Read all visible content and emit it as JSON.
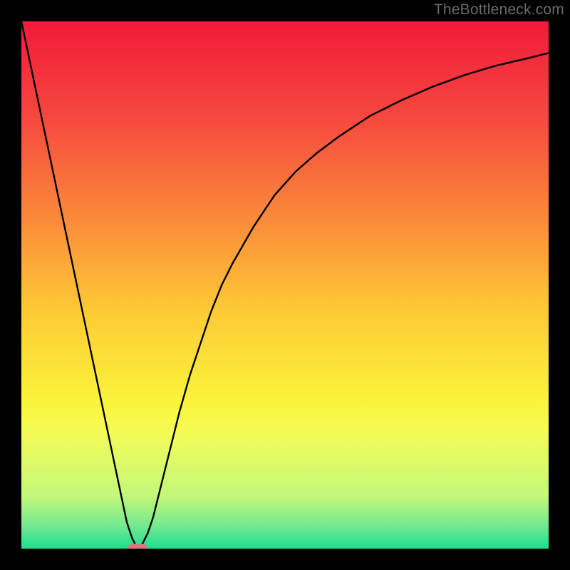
{
  "watermark": "TheBottleneck.com",
  "chart_data": {
    "type": "line",
    "title": "",
    "xlabel": "",
    "ylabel": "",
    "xlim": [
      0,
      100
    ],
    "ylim": [
      0,
      100
    ],
    "grid": false,
    "legend": false,
    "series": [
      {
        "name": "curve",
        "x": [
          0,
          2,
          4,
          6,
          8,
          10,
          12,
          14,
          16,
          18,
          20,
          21,
          22,
          23,
          24,
          25,
          26,
          28,
          30,
          32,
          34,
          36,
          38,
          40,
          44,
          48,
          52,
          56,
          60,
          66,
          72,
          78,
          84,
          90,
          96,
          100
        ],
        "y": [
          100,
          90.5,
          81,
          71.5,
          62,
          52.5,
          43,
          33.5,
          24,
          14.5,
          5,
          2,
          0,
          1,
          3,
          6,
          10,
          18,
          26,
          33,
          39,
          45,
          50,
          54,
          61,
          67,
          71.5,
          75,
          78,
          82,
          85,
          87.6,
          89.8,
          91.6,
          93,
          94
        ]
      }
    ],
    "marker": {
      "x": 22,
      "y": 0,
      "color": "#d77a7d"
    },
    "background_gradient_stops": [
      {
        "pct": 0,
        "color": "#f21a3a"
      },
      {
        "pct": 18,
        "color": "#f6473f"
      },
      {
        "pct": 38,
        "color": "#fb8c3a"
      },
      {
        "pct": 55,
        "color": "#feca36"
      },
      {
        "pct": 72,
        "color": "#fbf33a"
      },
      {
        "pct": 78,
        "color": "#f4fb57"
      },
      {
        "pct": 90,
        "color": "#c3f87a"
      },
      {
        "pct": 96,
        "color": "#6ee890"
      },
      {
        "pct": 100,
        "color": "#1adf8f"
      }
    ]
  }
}
